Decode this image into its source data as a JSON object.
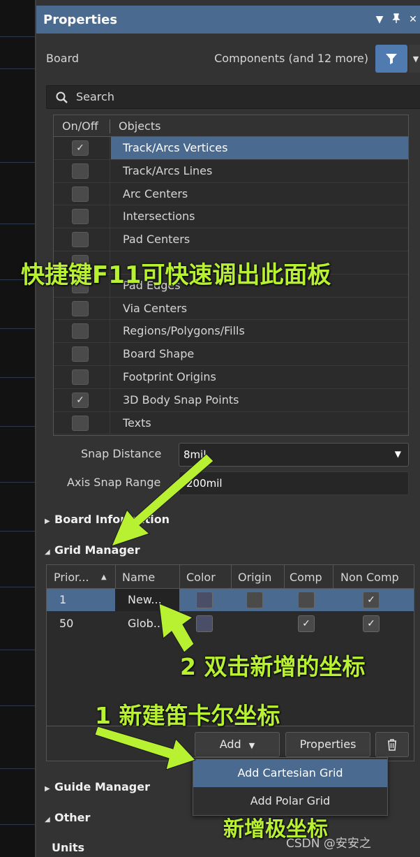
{
  "panel": {
    "title": "Properties",
    "title_icons": [
      "▼",
      "📌",
      "✕"
    ],
    "board_label": "Board",
    "components_label": "Components (and 12 more)",
    "search_placeholder": "Search"
  },
  "snap_table": {
    "header_onoff": "On/Off",
    "header_objects": "Objects",
    "rows": [
      {
        "label": "Track/Arcs Vertices",
        "checked": true,
        "selected": true
      },
      {
        "label": "Track/Arcs Lines",
        "checked": false
      },
      {
        "label": "Arc Centers",
        "checked": false
      },
      {
        "label": "Intersections",
        "checked": false
      },
      {
        "label": "Pad Centers",
        "checked": false
      },
      {
        "label": "",
        "checked": false
      },
      {
        "label": "Pad Edges",
        "checked": false
      },
      {
        "label": "Via Centers",
        "checked": false
      },
      {
        "label": "Regions/Polygons/Fills",
        "checked": false
      },
      {
        "label": "Board Shape",
        "checked": false
      },
      {
        "label": "Footprint Origins",
        "checked": false
      },
      {
        "label": "3D Body Snap Points",
        "checked": true
      },
      {
        "label": "Texts",
        "checked": false
      }
    ]
  },
  "snap_distance": {
    "label": "Snap Distance",
    "value": "8mil"
  },
  "axis_snap_range": {
    "label": "Axis Snap Range",
    "value": "200mil"
  },
  "sections": {
    "board_information": "Board Information",
    "grid_manager": "Grid Manager",
    "guide_manager": "Guide Manager",
    "other": "Other",
    "units": "Units"
  },
  "grid_table": {
    "headers": [
      "Prior...",
      "Name",
      "Color",
      "Origin",
      "Comp",
      "Non Comp"
    ],
    "rows": [
      {
        "priority": "1",
        "name": "New...",
        "comp": false,
        "non_comp": true
      },
      {
        "priority": "50",
        "name": "Glob...",
        "comp": true,
        "non_comp": true
      }
    ],
    "add_button": "Add",
    "properties_button": "Properties"
  },
  "add_menu": {
    "items": [
      "Add Cartesian Grid",
      "Add Polar Grid"
    ]
  },
  "annotations": {
    "shortcut": "快捷键F11可快速调出此面板",
    "step2": "2 双击新增的坐标",
    "step1": "1 新建笛卡尔坐标",
    "polar": "新增极坐标"
  },
  "watermark": "CSDN @安安之",
  "colors": {
    "accent": "#4b6a8f",
    "annotation": "#b8f032",
    "panel_bg": "#333333"
  }
}
